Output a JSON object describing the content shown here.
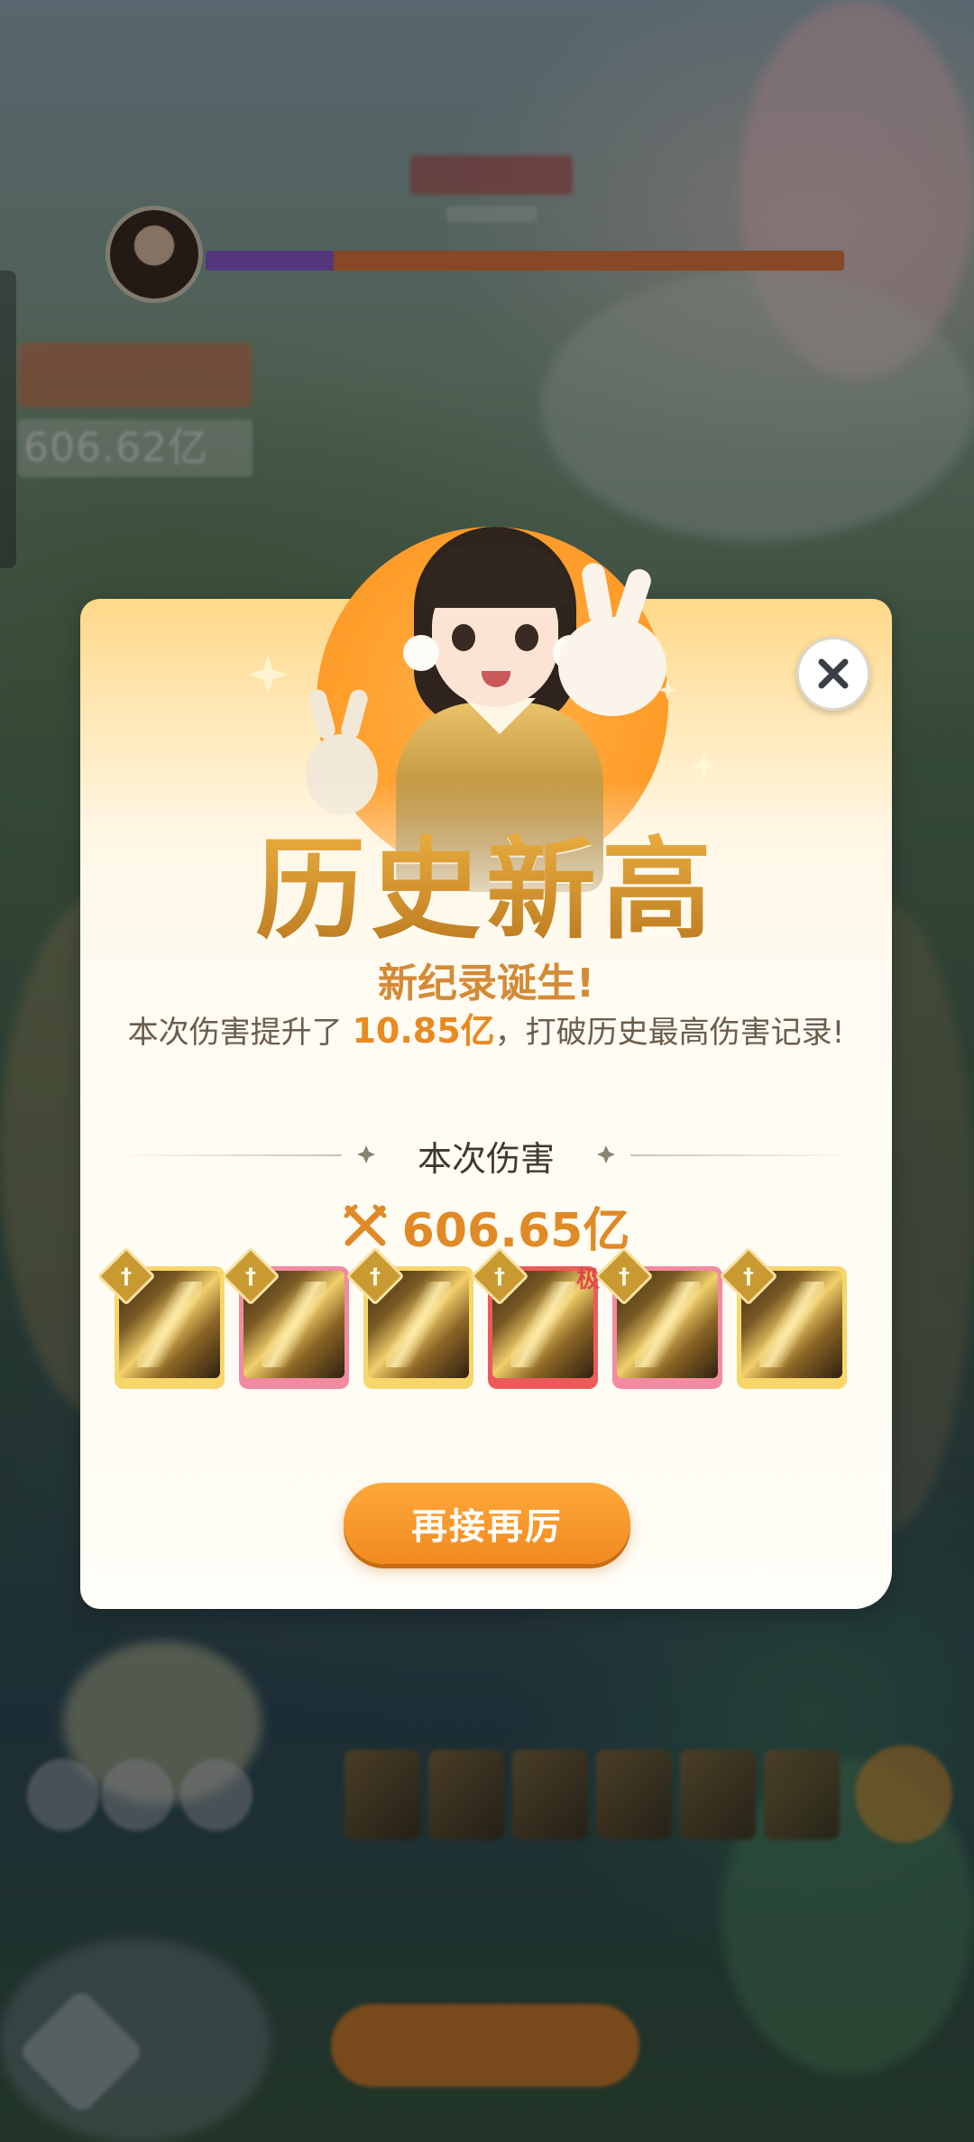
{
  "background": {
    "left_score": "606.62亿"
  },
  "dialog": {
    "title": "历史新高",
    "subtitle": "新纪录诞生!",
    "desc_prefix": "本次伤害提升了 ",
    "desc_highlight": "10.85亿",
    "desc_suffix": "，打破历史最高伤害记录!",
    "damage_label": "本次伤害",
    "damage_value": "606.65亿",
    "skill_tag": "极",
    "again_button": "再接再厉",
    "close_icon": "close-icon"
  },
  "skills": [
    {
      "name": "skill-1",
      "frame_color": "#f7d66a",
      "tag": false
    },
    {
      "name": "skill-2",
      "frame_color": "#f28aa0",
      "tag": false
    },
    {
      "name": "skill-3",
      "frame_color": "#f7d66a",
      "tag": false
    },
    {
      "name": "skill-4",
      "frame_color": "#ee5a5a",
      "tag": true
    },
    {
      "name": "skill-5",
      "frame_color": "#f28aa0",
      "tag": false
    },
    {
      "name": "skill-6",
      "frame_color": "#f7d66a",
      "tag": false
    }
  ],
  "colors": {
    "accent_orange": "#f08a1e",
    "highlight_text": "#e88a22",
    "title_gold": "#d39430"
  }
}
